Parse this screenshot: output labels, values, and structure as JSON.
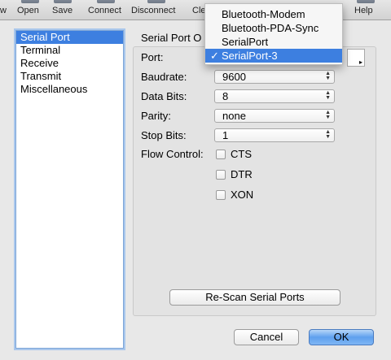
{
  "toolbar": {
    "items": [
      {
        "label": "w"
      },
      {
        "label": "Open"
      },
      {
        "label": "Save"
      },
      {
        "label": "Connect"
      },
      {
        "label": "Disconnect"
      },
      {
        "label": "Cle"
      },
      {
        "label": "Help"
      }
    ]
  },
  "sidebar": {
    "items": [
      {
        "label": "Serial Port",
        "selected": true
      },
      {
        "label": "Terminal"
      },
      {
        "label": "Receive"
      },
      {
        "label": "Transmit"
      },
      {
        "label": "Miscellaneous"
      }
    ]
  },
  "panel": {
    "group_title": "Serial Port O",
    "port_label": "Port:",
    "baudrate_label": "Baudrate:",
    "baudrate_value": "9600",
    "databits_label": "Data Bits:",
    "databits_value": "8",
    "parity_label": "Parity:",
    "parity_value": "none",
    "stopbits_label": "Stop Bits:",
    "stopbits_value": "1",
    "flow_label": "Flow Control:",
    "flow_options": [
      {
        "label": "CTS",
        "checked": false
      },
      {
        "label": "DTR",
        "checked": false
      },
      {
        "label": "XON",
        "checked": false
      }
    ],
    "rescan_label": "Re-Scan Serial Ports"
  },
  "port_menu": {
    "items": [
      {
        "label": "Bluetooth-Modem"
      },
      {
        "label": "Bluetooth-PDA-Sync"
      },
      {
        "label": "SerialPort"
      },
      {
        "label": "SerialPort-3",
        "selected": true
      }
    ],
    "check_glyph": "✓"
  },
  "footer": {
    "cancel_label": "Cancel",
    "ok_label": "OK"
  },
  "icons": {
    "arrows_glyph": "▲▼",
    "expand_glyph": "▸"
  },
  "colors": {
    "selection": "#3d7fe0",
    "default_button": "#5ea0ee"
  }
}
